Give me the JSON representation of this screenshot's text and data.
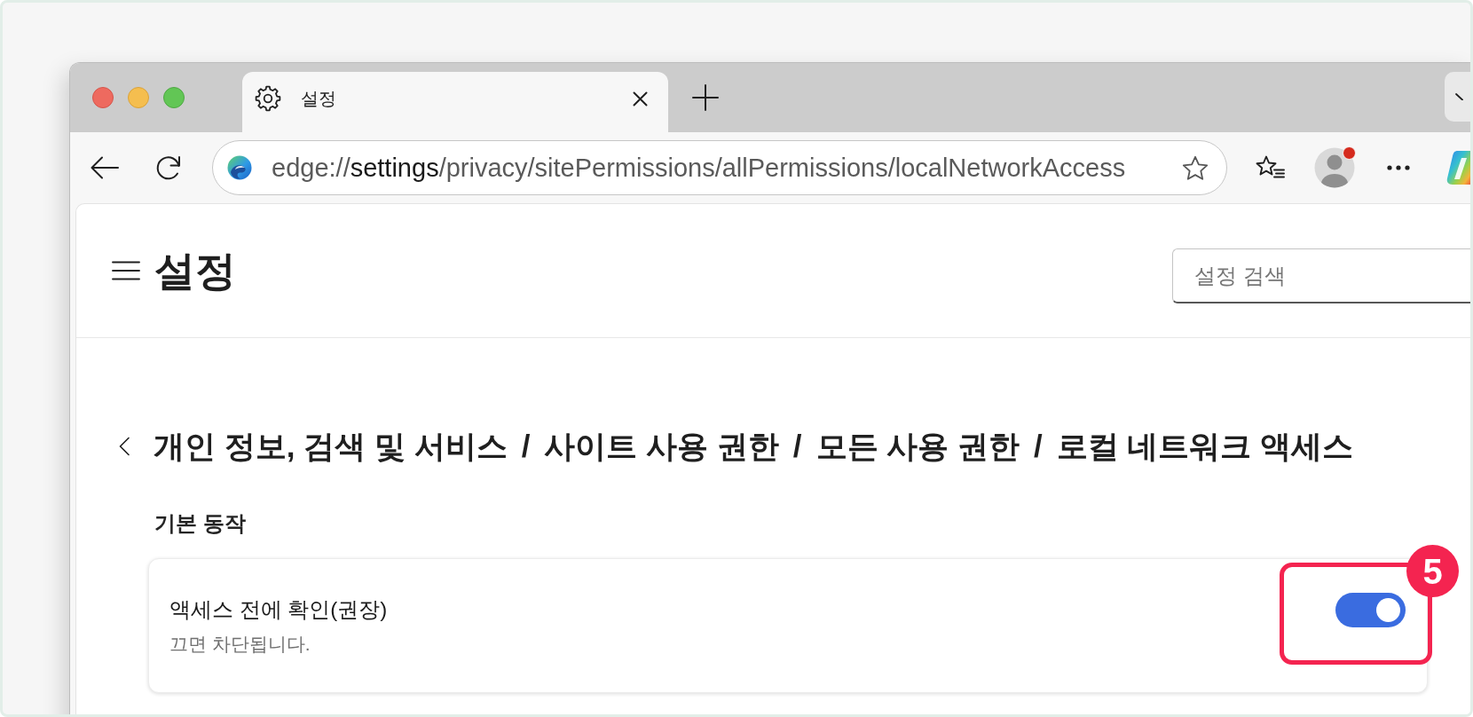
{
  "tabs": [
    {
      "title": "설정",
      "selected": true
    }
  ],
  "toolbar": {
    "address": {
      "scheme": "edge://",
      "host": "settings",
      "path": "/privacy/sitePermissions/allPermissions/localNetworkAccess"
    },
    "profile": {
      "notification": true
    }
  },
  "header": {
    "title": "설정",
    "search": {
      "placeholder": "설정 검색"
    }
  },
  "breadcrumb": [
    {
      "kind": "crumb",
      "label": "개인 정보, 검색 및 서비스"
    },
    {
      "kind": "separator",
      "label": "/"
    },
    {
      "kind": "crumb",
      "label": "사이트 사용 권한"
    },
    {
      "kind": "separator",
      "label": "/"
    },
    {
      "kind": "crumb",
      "label": "모든 사용 권한"
    },
    {
      "kind": "separator",
      "label": "/"
    },
    {
      "kind": "crumb",
      "label": "로컬 네트워크 액세스"
    }
  ],
  "section": {
    "title": "기본 동작",
    "settings": [
      {
        "title": "액세스 전에 확인(권장)",
        "description": "끄면 차단됩니다.",
        "on": true,
        "callout": "5"
      }
    ]
  }
}
